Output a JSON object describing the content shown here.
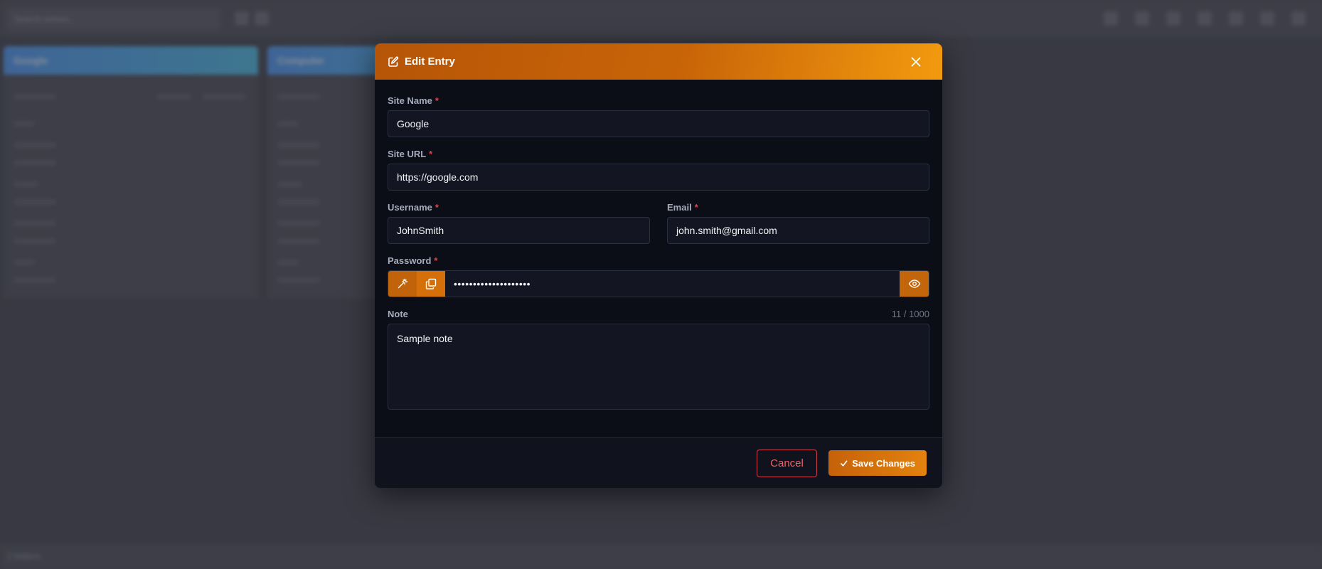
{
  "background": {
    "search_placeholder": "Search entries...",
    "cards": [
      {
        "title": "Google"
      },
      {
        "title": "Computer"
      }
    ],
    "footer_text": "2 folders"
  },
  "modal": {
    "title": "Edit Entry",
    "header_icon": "edit-icon",
    "close_icon": "close-icon",
    "fields": {
      "site_name": {
        "label": "Site Name",
        "required": "*",
        "value": "Google"
      },
      "site_url": {
        "label": "Site URL",
        "required": "*",
        "value": "https://google.com"
      },
      "username": {
        "label": "Username",
        "required": "*",
        "value": "JohnSmith"
      },
      "email": {
        "label": "Email",
        "required": "*",
        "value": "john.smith@gmail.com"
      },
      "password": {
        "label": "Password",
        "required": "*",
        "value": "••••••••••••••••••••",
        "generate_icon": "magic-wand-icon",
        "copy_icon": "copy-icon",
        "reveal_icon": "eye-icon"
      },
      "note": {
        "label": "Note",
        "value": "Sample note",
        "counter": "11 / 1000"
      }
    },
    "footer": {
      "cancel_label": "Cancel",
      "save_label": "Save Changes",
      "save_icon": "check-icon"
    }
  },
  "colors": {
    "accent": "#e07d0e",
    "accent_dark": "#b65507",
    "danger": "#e0434b",
    "modal_bg": "#0b0e17",
    "input_bg": "#131622"
  }
}
